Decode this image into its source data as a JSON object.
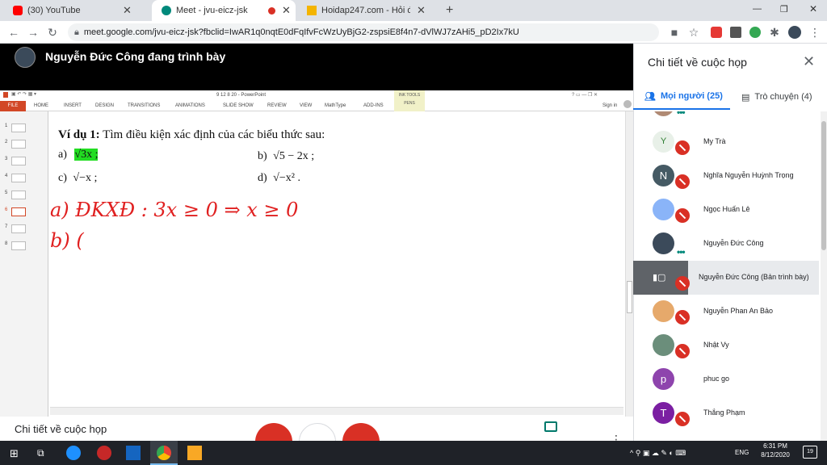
{
  "browser": {
    "tabs": [
      {
        "title": "(30) YouTube",
        "close": "✕"
      },
      {
        "title": "Meet - jvu-eicz-jsk",
        "close": "✕"
      },
      {
        "title": "Hoidap247.com - Hỏi đáp online",
        "close": "✕"
      }
    ],
    "new_tab": "+",
    "url": "meet.google.com/jvu-eicz-jsk?fbclid=IwAR1q0nqtE0dFqIfvFcWzUyBjG2-zspsiE8f4n7-dVlWJ7zAHi5_pD2Ix7kU",
    "window_controls": {
      "minimize": "—",
      "maximize": "❐",
      "close": "✕"
    }
  },
  "meet": {
    "presenter_label": "Nguyễn Đức Công đang trình bày",
    "bottom_details": "Chi tiết về cuộc họp",
    "panel": {
      "title": "Chi tiết về cuộc họp",
      "tab_people": "Mọi người (25)",
      "tab_chat": "Trò chuyện (4)",
      "people": [
        {
          "name": "My Trà",
          "initial": "",
          "color": "#f5f5f5",
          "state": "muted"
        },
        {
          "name": "Nghĩa Nguyễn Huỳnh Trọng",
          "initial": "N",
          "color": "#5f6368",
          "state": "muted"
        },
        {
          "name": "Ngọc Huấn Lê",
          "initial": "",
          "color": "#8ab4f8",
          "state": "muted"
        },
        {
          "name": "Nguyễn Đức Công",
          "initial": "",
          "color": "#3b4a5a",
          "state": "speaking"
        },
        {
          "name": "Nguyễn Đức Công (Bản trình bày)",
          "initial": "",
          "color": "#5f6368",
          "state": "presenting"
        },
        {
          "name": "Nguyễn Phan An Bảo",
          "initial": "",
          "color": "#e6a96b",
          "state": "muted"
        },
        {
          "name": "Nhật Vy",
          "initial": "",
          "color": "#6b8e7b",
          "state": "muted"
        },
        {
          "name": "phuc go",
          "initial": "p",
          "color": "#8e44ad",
          "state": "none"
        },
        {
          "name": "Thắng Phạm",
          "initial": "T",
          "color": "#7b1fa2",
          "state": "muted"
        }
      ]
    }
  },
  "powerpoint": {
    "title": "9 12 8 20 - PowerPoint",
    "ink_tools": "INK TOOLS",
    "pens": "PENS",
    "sign_in": "Sign in",
    "ribbon_tabs": [
      "HOME",
      "INSERT",
      "DESIGN",
      "TRANSITIONS",
      "ANIMATIONS",
      "SLIDE SHOW",
      "REVIEW",
      "VIEW",
      "MathType",
      "ADD-INS"
    ],
    "file_tab": "FILE",
    "slide_numbers": [
      "1",
      "2",
      "3",
      "4",
      "5",
      "6",
      "7",
      "8"
    ],
    "selected_slide": 6,
    "slide": {
      "heading_bold": "Ví dụ 1:",
      "heading_rest": " Tìm điều kiện xác định của các biểu thức sau:",
      "items": [
        {
          "label": "a)",
          "expr": "√3x ;"
        },
        {
          "label": "b)",
          "expr": "√5 − 2x ;"
        },
        {
          "label": "c)",
          "expr": "√−x ;"
        },
        {
          "label": "d)",
          "expr": "√−x² ."
        }
      ],
      "handwriting": [
        "a)  ĐKXĐ : 3x ≥ 0      ⇒ x ≥ 0",
        "b)  ("
      ]
    }
  },
  "taskbar": {
    "lang": "ENG",
    "time": "6:31 PM",
    "date": "8/12/2020",
    "notifications": "19"
  }
}
